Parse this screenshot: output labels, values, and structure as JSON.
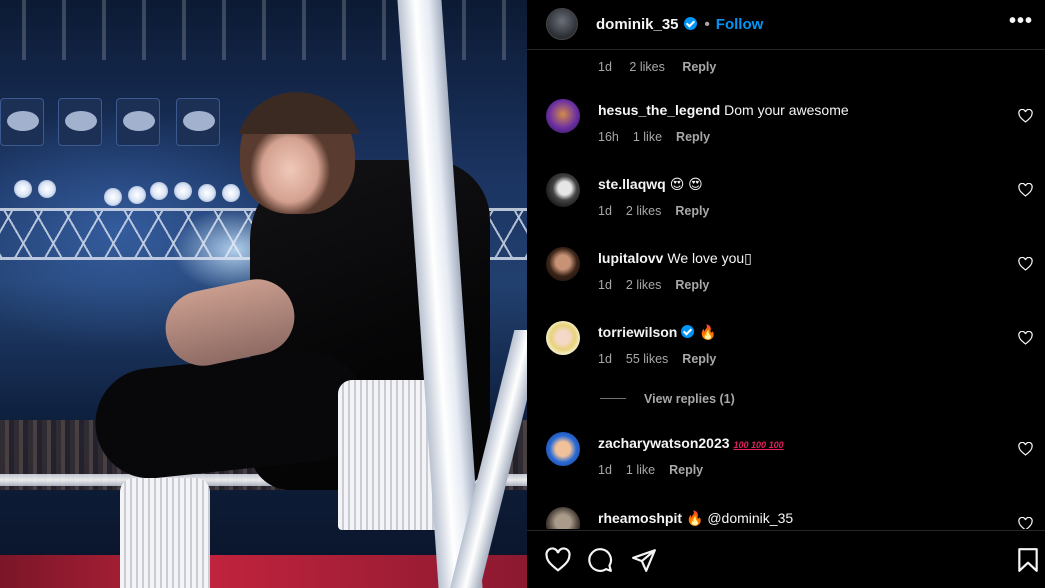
{
  "post": {
    "author": "dominik_35",
    "follow_label": "Follow",
    "separator": "•",
    "more_label": "•••"
  },
  "top_meta": {
    "time": "1d",
    "likes": "2 likes",
    "reply": "Reply"
  },
  "comments": [
    {
      "user": "hesus_the_legend",
      "text": "Dom your awesome",
      "time": "16h",
      "likes": "1 like",
      "reply": "Reply"
    },
    {
      "user": "ste.llaqwq",
      "text": "😍 😍",
      "time": "1d",
      "likes": "2 likes",
      "reply": "Reply"
    },
    {
      "user": "lupitalovv",
      "text": "We love you▯",
      "time": "1d",
      "likes": "2 likes",
      "reply": "Reply"
    },
    {
      "user": "torriewilson",
      "text": "🔥",
      "time": "1d",
      "likes": "55 likes",
      "reply": "Reply",
      "verified": true
    },
    {
      "user": "zacharywatson2023",
      "text": "100 100 100",
      "time": "1d",
      "likes": "1 like",
      "reply": "Reply"
    },
    {
      "user": "rheamoshpit",
      "text": "🔥 @dominik_35"
    }
  ],
  "view_replies": "View replies (1)",
  "icons": {
    "like": "heart-icon",
    "comment": "comment-icon",
    "share": "send-icon",
    "save": "bookmark-icon"
  },
  "colors": {
    "accent": "#0095f6",
    "background": "#000000",
    "muted": "#a8a8a8"
  }
}
